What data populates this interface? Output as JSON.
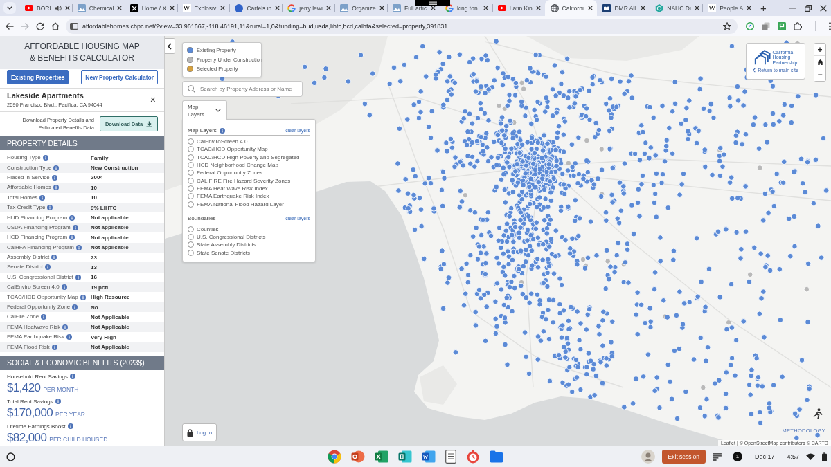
{
  "browser": {
    "tabs": [
      {
        "title": "BORI",
        "kind": "video",
        "audio": true,
        "selected": false
      },
      {
        "title": "Chemical",
        "kind": "image",
        "audio": false,
        "selected": false
      },
      {
        "title": "Home / X",
        "kind": "x",
        "audio": false,
        "selected": false
      },
      {
        "title": "Explosiv",
        "kind": "letter",
        "glyph": "W",
        "audio": false,
        "selected": false
      },
      {
        "title": "Cartels in",
        "kind": "circle",
        "audio": false,
        "selected": false
      },
      {
        "title": "jerry lewi",
        "kind": "ring",
        "audio": false,
        "selected": false
      },
      {
        "title": "Organize",
        "kind": "image",
        "audio": false,
        "selected": false
      },
      {
        "title": "Full artic",
        "kind": "image",
        "audio": false,
        "selected": false
      },
      {
        "title": "king ton",
        "kind": "ring",
        "audio": false,
        "selected": false
      },
      {
        "title": "Latin Kin",
        "kind": "video",
        "audio": false,
        "selected": false
      },
      {
        "title": "Californi",
        "kind": "globe",
        "audio": false,
        "selected": true
      },
      {
        "title": "DMR All",
        "kind": "book",
        "audio": false,
        "selected": false
      },
      {
        "title": "NAHC Di",
        "kind": "hexagon",
        "audio": false,
        "selected": false
      },
      {
        "title": "People A",
        "kind": "letter",
        "glyph": "W",
        "audio": false,
        "selected": false
      }
    ],
    "new_tab": "+",
    "forward_disabled": true,
    "url": "affordablehomes.chpc.net/?view=33.961667,-118.46191,11&rural=1,0&funding=hud,usda,lihtc,hcd,calhfa&selected=property,391831"
  },
  "sidebar": {
    "title": [
      "AFFORDABLE HOUSING MAP",
      "& BENEFITS CALCULATOR"
    ],
    "modes": [
      {
        "label": "Existing Properties",
        "selected": true
      },
      {
        "label": "New Property Calculator",
        "selected": false
      }
    ],
    "property": {
      "name": "Lakeside Apartments",
      "address": "2590 Francisco Blvd., Pacifica, CA 94044",
      "close": "×"
    },
    "download": {
      "text": [
        "Download Property Details and",
        "Estimated Benefits Data"
      ],
      "button": "Download Data"
    },
    "details_heading": "PROPERTY DETAILS",
    "details": [
      {
        "label": "Housing Type",
        "value": "Family"
      },
      {
        "label": "Construction Type",
        "value": "New Construction"
      },
      {
        "label": "Placed in Service",
        "value": "2004"
      },
      {
        "label": "Affordable Homes",
        "value": "10"
      },
      {
        "label": "Total Homes",
        "value": "10"
      },
      {
        "label": "Tax Credit Type",
        "value": "9% LIHTC"
      },
      {
        "label": "HUD Financing Program",
        "value": "Not applicable"
      },
      {
        "label": "USDA Financing Program",
        "value": "Not applicable"
      },
      {
        "label": "HCD Financing Program",
        "value": "Not applicable"
      },
      {
        "label": "CalHFA Financing Program",
        "value": "Not applicable"
      },
      {
        "label": "Assembly District",
        "value": "23"
      },
      {
        "label": "Senate District",
        "value": "13"
      },
      {
        "label": "U.S. Congressional District",
        "value": "16"
      },
      {
        "label": "CalEnviro Screen 4.0",
        "value": "19 pctl"
      },
      {
        "label": "TCAC/HCD Opportunity Map",
        "value": "High Resource"
      },
      {
        "label": "Federal Opportunity Zone",
        "value": "No"
      },
      {
        "label": "CalFire Zone",
        "value": "Not Applicable"
      },
      {
        "label": "FEMA Heatwave Risk",
        "value": "Not Applicable"
      },
      {
        "label": "FEMA Earthquake Risk",
        "value": "Very High"
      },
      {
        "label": "FEMA Flood Risk",
        "value": "Not Applicable"
      }
    ],
    "benefits_heading": "SOCIAL & ECONOMIC BENEFITS (2023$)",
    "benefits": [
      {
        "label": "Household Rent Savings",
        "amount": "$1,420",
        "unit": "PER MONTH"
      },
      {
        "label": "Total Rent Savings",
        "amount": "$170,000",
        "unit": "PER YEAR"
      },
      {
        "label": "Lifetime Earnings Boost",
        "amount": "$82,000",
        "unit": "PER CHILD HOUSED"
      }
    ]
  },
  "map": {
    "legend": [
      {
        "label": "Existing Property",
        "color": "#5b8ad6"
      },
      {
        "label": "Property Under Construction",
        "color": "#b9b9b9"
      },
      {
        "label": "Selected Property",
        "color": "#d6a13f"
      }
    ],
    "search": {
      "placeholder": "Search by Property Address or Name"
    },
    "layers_toggle": {
      "label": "Map Layers",
      "expanded": true
    },
    "layer_groups": [
      {
        "title": "Map Layers",
        "info": true,
        "clear": "clear layers",
        "options": [
          {
            "label": "CalEnviroScreen 4.0",
            "checked": false
          },
          {
            "label": "TCAC/HCD Opportunity Map",
            "checked": false
          },
          {
            "label": "TCAC/HCD High Poverty and Segregated",
            "checked": false
          },
          {
            "label": "HCD Neighborhood Change Map",
            "checked": false
          },
          {
            "label": "Federal Opportunity Zones",
            "checked": false
          },
          {
            "label": "CAL FIRE Fire Hazard Severity Zones",
            "checked": false
          },
          {
            "label": "FEMA Heat Wave Risk Index",
            "checked": false
          },
          {
            "label": "FEMA Earthquake Risk Index",
            "checked": false
          },
          {
            "label": "FEMA National Flood Hazard Layer",
            "checked": false
          }
        ]
      },
      {
        "title": "Boundaries",
        "info": false,
        "clear": "clear layers",
        "options": [
          {
            "label": "Counties",
            "checked": false
          },
          {
            "label": "U.S. Congressional Districts",
            "checked": false
          },
          {
            "label": "State Assembly Districts",
            "checked": false
          },
          {
            "label": "State Senate Districts",
            "checked": false
          }
        ]
      }
    ],
    "login": "Log In",
    "logo": {
      "name": [
        "California",
        "Housing",
        "Partnership"
      ],
      "link": "Return to main site"
    },
    "zoom": {
      "in": "+",
      "out": "−"
    },
    "methodology": "METHODOLOGY",
    "attribution": "Leaflet | © OpenStreetMap contributors © CARTO"
  },
  "taskbar": {
    "apps": [
      {
        "kind": "browser"
      },
      {
        "kind": "presentation"
      },
      {
        "kind": "spreadsheet"
      },
      {
        "kind": "publishing"
      },
      {
        "kind": "document"
      },
      {
        "kind": "notes"
      },
      {
        "kind": "stopwatch"
      },
      {
        "kind": "folder"
      }
    ],
    "exit_button": "Exit session",
    "notification_count": "1",
    "date": "Dec 17",
    "time": "4:57"
  }
}
